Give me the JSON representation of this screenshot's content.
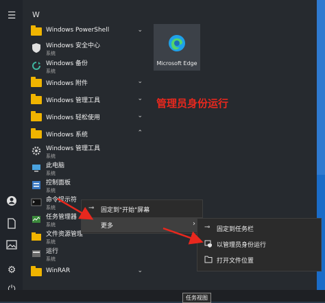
{
  "list": {
    "letter_header": "W",
    "items": [
      {
        "label": "Windows PowerShell",
        "type": "folder",
        "expand": "⌄"
      },
      {
        "label": "Windows 安全中心",
        "sub": "系统",
        "type": "app"
      },
      {
        "label": "Windows 备份",
        "sub": "系统",
        "type": "app"
      },
      {
        "label": "Windows 附件",
        "type": "folder",
        "expand": "⌄"
      },
      {
        "label": "Windows 管理工具",
        "type": "folder",
        "expand": "⌄"
      },
      {
        "label": "Windows 轻松使用",
        "type": "folder",
        "expand": "⌄"
      },
      {
        "label": "Windows 系统",
        "type": "folder",
        "expand": "⌃"
      },
      {
        "label": "Windows 管理工具",
        "sub": "系统",
        "type": "app"
      },
      {
        "label": "此电脑",
        "sub": "系统",
        "type": "app"
      },
      {
        "label": "控制面板",
        "sub": "系统",
        "type": "app"
      },
      {
        "label": "命令提示符",
        "sub": "系统",
        "type": "app"
      },
      {
        "label": "任务管理器",
        "sub": "系统",
        "type": "app"
      },
      {
        "label": "文件资源管理",
        "sub": "系统",
        "type": "app"
      },
      {
        "label": "运行",
        "sub": "系统",
        "type": "app"
      },
      {
        "label": "WinRAR",
        "type": "folder",
        "expand": "⌄"
      }
    ]
  },
  "tile": {
    "label": "Microsoft Edge"
  },
  "annotation": "管理员身份运行",
  "context_menu": {
    "items": [
      {
        "label": "固定到\"开始\"屏幕",
        "icon": "pin-icon"
      },
      {
        "label": "更多",
        "icon": "",
        "submenu_arrow": "›"
      }
    ]
  },
  "submenu": {
    "items": [
      {
        "label": "固定到任务栏",
        "icon": "pin-icon"
      },
      {
        "label": "以管理员身份运行",
        "icon": "shield-run-icon"
      },
      {
        "label": "打开文件位置",
        "icon": "folder-open-icon"
      }
    ]
  },
  "taskbar": {
    "tooltip": "任务视图"
  },
  "colors": {
    "annotation": "#e8281e",
    "folder": "#f0b400",
    "accent": "#1a6cc8"
  }
}
